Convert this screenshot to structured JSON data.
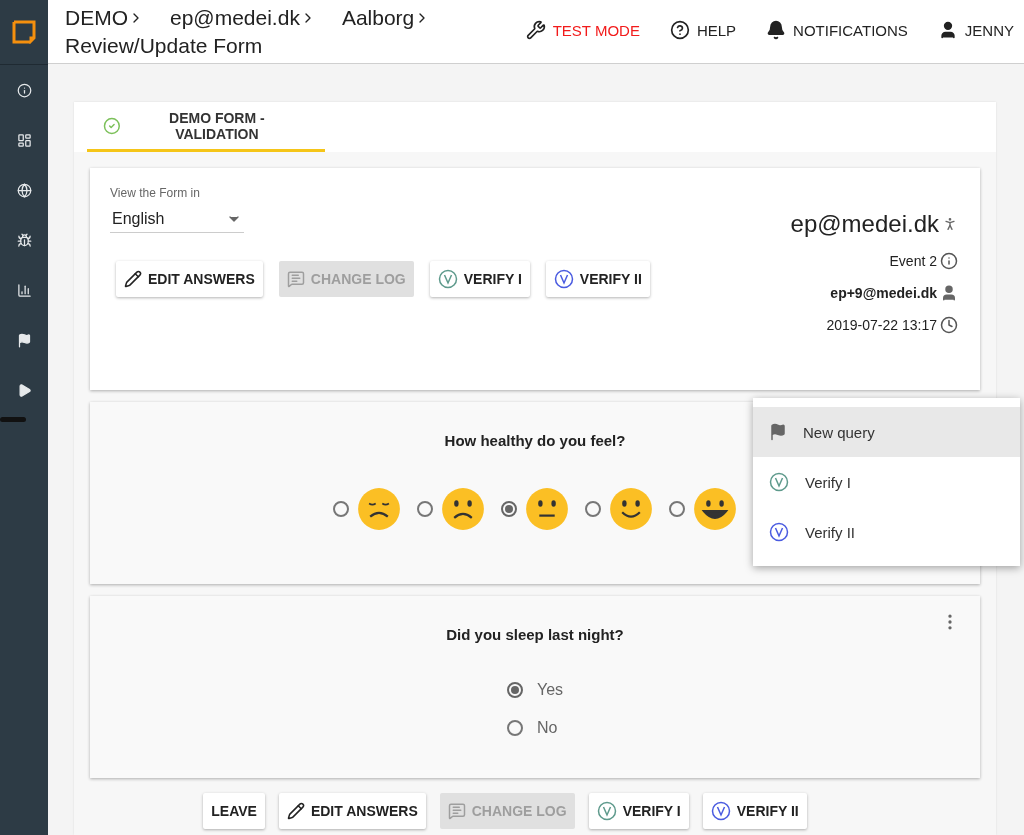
{
  "breadcrumbs": [
    "DEMO",
    "ep@medei.dk",
    "Aalborg",
    "Review/Update Form"
  ],
  "top_actions": [
    {
      "kind": "test",
      "label": "TEST MODE"
    },
    {
      "kind": "help",
      "label": "HELP"
    },
    {
      "kind": "bell",
      "label": "NOTIFICATIONS"
    },
    {
      "kind": "user",
      "label": "JENNY"
    }
  ],
  "sidebar": {
    "items": [
      {
        "kind": "info"
      },
      {
        "kind": "dashboard"
      },
      {
        "kind": "globe"
      },
      {
        "kind": "bug"
      },
      {
        "kind": "chart"
      },
      {
        "kind": "flag"
      },
      {
        "kind": "play"
      }
    ]
  },
  "tab": {
    "label": "DEMO FORM - VALIDATION",
    "selected": true
  },
  "language": {
    "label": "View the Form in",
    "value": "English"
  },
  "buttons": [
    {
      "kind": "edit",
      "label": "EDIT ANSWERS",
      "disabled": false
    },
    {
      "kind": "log",
      "label": "CHANGE LOG",
      "disabled": true
    },
    {
      "kind": "verify1",
      "label": "VERIFY I",
      "disabled": false
    },
    {
      "kind": "verify2",
      "label": "VERIFY II",
      "disabled": false
    }
  ],
  "info": {
    "title": "ep@medei.dk",
    "event": "Event 2",
    "user": "ep+9@medei.dk",
    "date": "2019-07-22 13:17"
  },
  "questions": [
    {
      "kind": "emoji",
      "text": "How healthy do you feel?",
      "options": [
        {
          "selected": false
        },
        {
          "selected": false
        },
        {
          "selected": true
        },
        {
          "selected": false
        },
        {
          "selected": false
        }
      ]
    },
    {
      "kind": "radio",
      "text": "Did you sleep last night?",
      "options": [
        {
          "label": "Yes",
          "selected": true
        },
        {
          "label": "No",
          "selected": false
        }
      ]
    }
  ],
  "menu": [
    {
      "kind": "flag",
      "label": "New query",
      "highlighted": true
    },
    {
      "kind": "verify1",
      "label": "Verify I",
      "highlighted": false
    },
    {
      "kind": "verify2",
      "label": "Verify II",
      "highlighted": false
    }
  ],
  "bottom_buttons": [
    {
      "kind": "leave",
      "label": "LEAVE",
      "disabled": false
    },
    {
      "kind": "edit",
      "label": "EDIT ANSWERS",
      "disabled": false
    },
    {
      "kind": "log",
      "label": "CHANGE LOG",
      "disabled": true
    },
    {
      "kind": "verify1",
      "label": "VERIFY I",
      "disabled": false
    },
    {
      "kind": "verify2",
      "label": "VERIFY II",
      "disabled": false
    }
  ]
}
